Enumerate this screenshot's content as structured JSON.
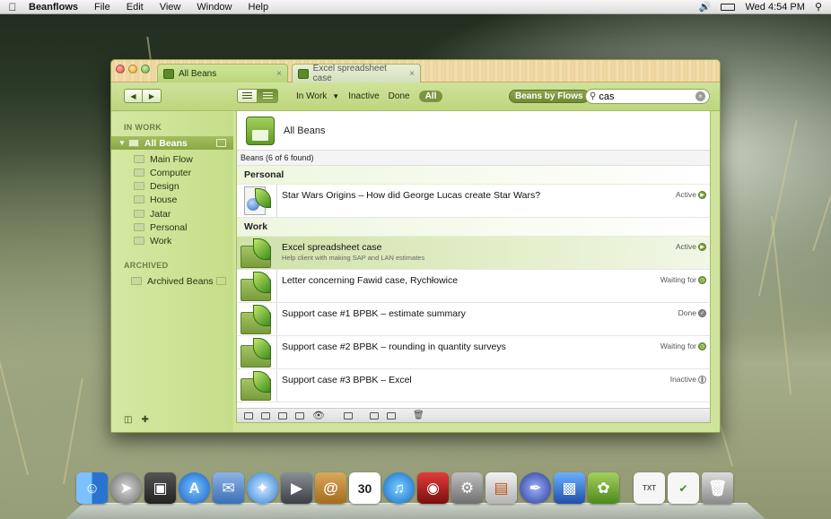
{
  "menubar": {
    "app_name": "Beanflows",
    "items": [
      "File",
      "Edit",
      "View",
      "Window",
      "Help"
    ],
    "clock": "Wed 4:54 PM"
  },
  "tabs": [
    {
      "label": "All Beans",
      "close": "×"
    },
    {
      "label": "Excel spreadsheet case",
      "close": "×"
    }
  ],
  "toolbar": {
    "back": "◀",
    "forward": "▶",
    "filters": {
      "in_work": "In Work",
      "inactive": "Inactive",
      "done": "Done",
      "all": "All"
    },
    "flows_button": "Beans by Flows",
    "search": {
      "value": "cas",
      "clear": "×"
    }
  },
  "sidebar": {
    "in_work_header": "IN WORK",
    "all_beans": "All Beans",
    "flows": [
      "Main Flow",
      "Computer",
      "Design",
      "House",
      "Jatar",
      "Personal",
      "Work"
    ],
    "archived_header": "ARCHIVED",
    "archived_beans": "Archived Beans"
  },
  "main": {
    "title": "All Beans",
    "found": "Beans (6 of 6 found)",
    "groups": [
      {
        "name": "Personal",
        "rows": [
          {
            "title": "Star Wars Origins – How did George Lucas create Star Wars?",
            "sub": "",
            "status": "Active",
            "status_icon": "play-circle-icon"
          }
        ]
      },
      {
        "name": "Work",
        "rows": [
          {
            "title": "Excel spreadsheet case",
            "sub": "Help client with making SAP and LAN estimates",
            "status": "Active",
            "status_icon": "play-circle-icon"
          },
          {
            "title": "Letter concerning Fawid case, Rychłowice",
            "sub": "",
            "status": "Waiting for",
            "status_icon": "clock-circle-icon"
          },
          {
            "title": "Support case #1 BPBK – estimate summary",
            "sub": "",
            "status": "Done",
            "status_icon": "check-circle-icon"
          },
          {
            "title": "Support case #2 BPBK – rounding in quantity surveys",
            "sub": "",
            "status": "Waiting for",
            "status_icon": "clock-circle-icon"
          },
          {
            "title": "Support case #3 BPBK – Excel",
            "sub": "",
            "status": "Inactive",
            "status_icon": "pause-circle-icon"
          }
        ]
      }
    ]
  },
  "dock": {
    "calendar_day": "30",
    "items": [
      "finder-icon",
      "launchpad-icon",
      "photo-browser-icon",
      "app-store-icon",
      "mail-icon",
      "safari-icon",
      "facetime-icon",
      "contacts-icon",
      "calendar-icon",
      "itunes-icon",
      "photo-booth-icon",
      "system-preferences-icon",
      "keynote-icon",
      "pen-tool-icon",
      "chart-app-icon",
      "beanflows-icon",
      "txt-document-icon",
      "preview-document-icon",
      "trash-icon"
    ]
  },
  "colors": {
    "accent_green": "#7a9440",
    "sidebar_selected": "#8aa746",
    "window_bg": "#cfe49a"
  }
}
